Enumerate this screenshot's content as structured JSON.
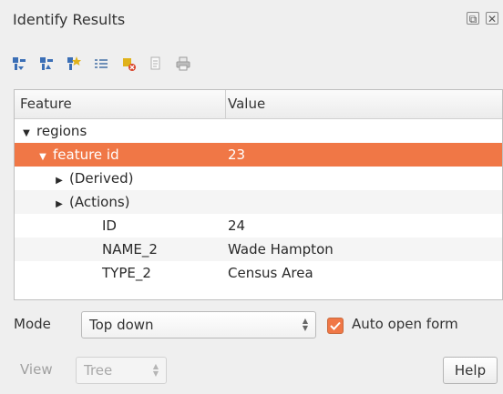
{
  "window": {
    "title": "Identify Results",
    "float_icon": "⧉",
    "close_icon": "✕"
  },
  "toolbar": {
    "icons": [
      {
        "name": "expand-tree-icon",
        "color": "#3b6fb6"
      },
      {
        "name": "collapse-tree-icon",
        "color": "#3b6fb6"
      },
      {
        "name": "expand-new-results-icon",
        "color": "#e0b21b"
      },
      {
        "name": "clear-results-icon",
        "color": "#6e8fb8"
      },
      {
        "name": "clear-highlights-icon",
        "color": "#e0b21b"
      },
      {
        "name": "copy-feature-icon",
        "color": "#b0b0b0"
      },
      {
        "name": "print-icon",
        "color": "#9a9a9a"
      }
    ]
  },
  "tree": {
    "headers": {
      "feature": "Feature",
      "value": "Value"
    },
    "rows": [
      {
        "feature": "regions",
        "value": "",
        "indent": 0,
        "arrow": "▼",
        "selected": false
      },
      {
        "feature": "feature id",
        "value": "23",
        "indent": 1,
        "arrow": "▼",
        "selected": true
      },
      {
        "feature": "(Derived)",
        "value": "",
        "indent": 2,
        "arrow": "▶",
        "selected": false
      },
      {
        "feature": "(Actions)",
        "value": "",
        "indent": 2,
        "arrow": "▶",
        "selected": false
      },
      {
        "feature": "ID",
        "value": "24",
        "indent": 3,
        "arrow": "",
        "selected": false
      },
      {
        "feature": "NAME_2",
        "value": "Wade Hampton",
        "indent": 3,
        "arrow": "",
        "selected": false
      },
      {
        "feature": "TYPE_2",
        "value": "Census Area",
        "indent": 3,
        "arrow": "",
        "selected": false
      }
    ]
  },
  "mode": {
    "label": "Mode",
    "value": "Top down"
  },
  "auto_open_form": {
    "label": "Auto open form",
    "checked": true
  },
  "view": {
    "label": "View",
    "value": "Tree"
  },
  "help_label": "Help",
  "colors": {
    "selection": "#f07746",
    "accent": "#f07746"
  }
}
